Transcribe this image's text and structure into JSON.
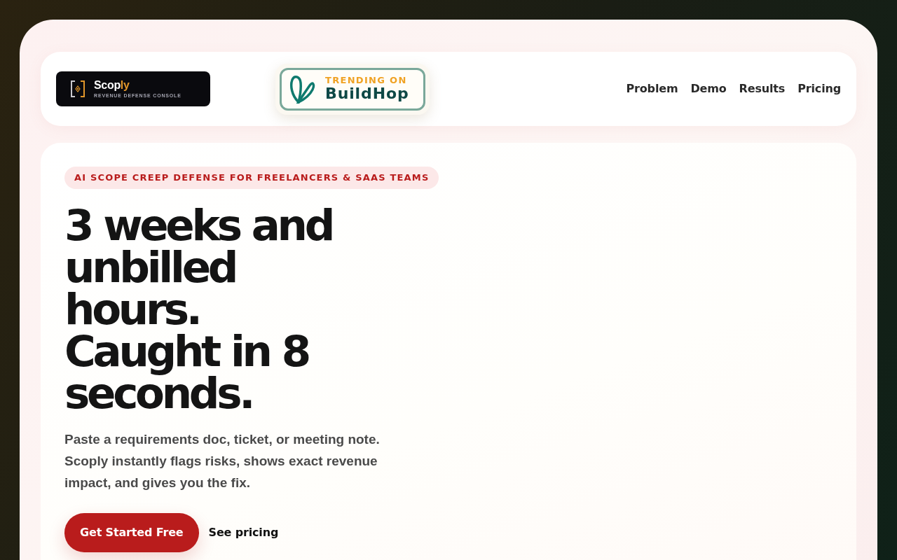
{
  "header": {
    "logo": {
      "name": "Scop",
      "name_accent": "ly",
      "tagline": "REVENUE DEFENSE CONSOLE"
    },
    "badge": {
      "kicker": "TRENDING ON",
      "name": "BuildHop"
    },
    "nav": [
      "Problem",
      "Demo",
      "Results",
      "Pricing"
    ]
  },
  "hero": {
    "eyebrow": "AI SCOPE CREEP DEFENSE FOR FREELANCERS & SAAS TEAMS",
    "headline": "3 weeks and unbilled hours. Caught in 8 seconds.",
    "description": "Paste a requirements doc, ticket, or meeting note. Scoply instantly flags risks, shows exact revenue impact, and gives you the fix.",
    "actions": [
      {
        "label": "Get Started Free",
        "kind": "primary"
      },
      {
        "label": "See pricing",
        "kind": "link"
      }
    ]
  }
}
